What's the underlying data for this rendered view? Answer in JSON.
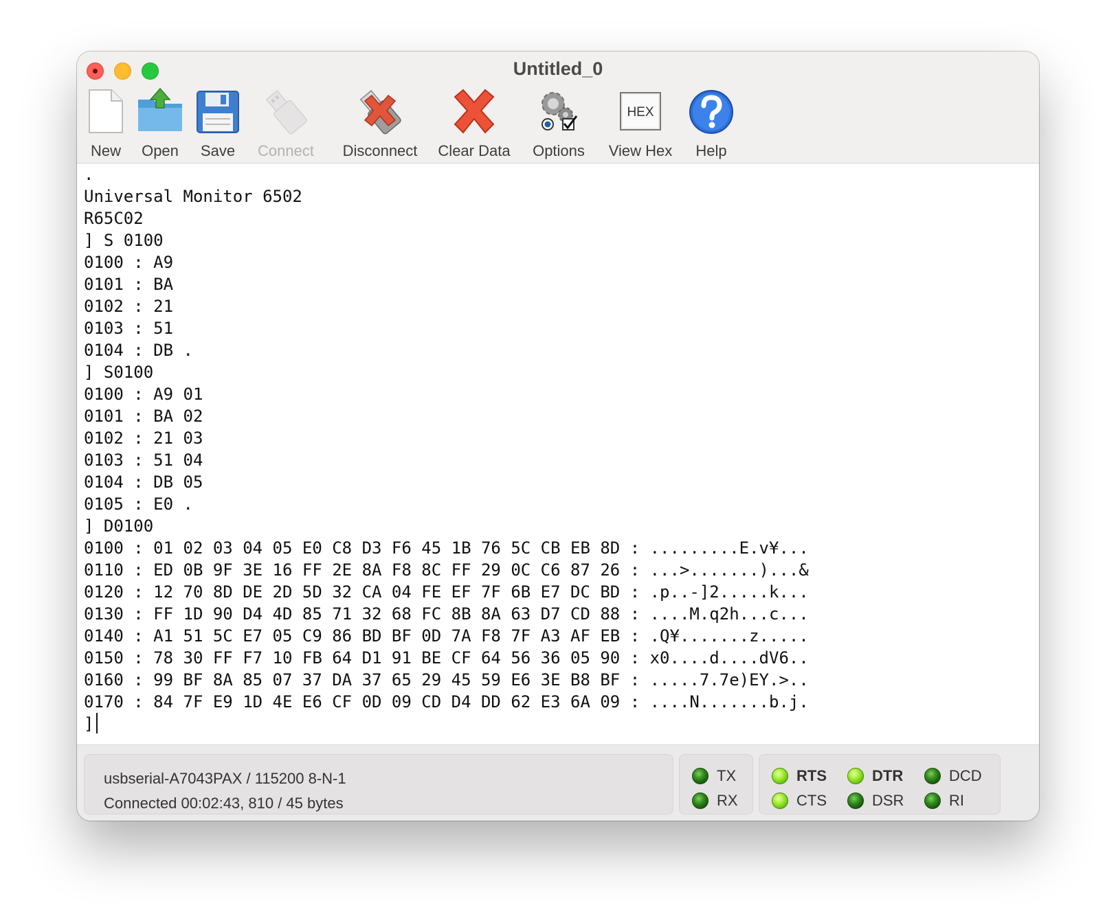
{
  "window": {
    "title": "Untitled_0"
  },
  "toolbar": {
    "new_label": "New",
    "open_label": "Open",
    "save_label": "Save",
    "connect_label": "Connect",
    "disconnect_label": "Disconnect",
    "clear_label": "Clear Data",
    "options_label": "Options",
    "viewhex_label": "View Hex",
    "viewhex_icon_text": "HEX",
    "help_label": "Help"
  },
  "terminal": {
    "lines": [
      ".",
      "Universal Monitor 6502",
      "R65C02",
      "] S 0100",
      "0100 : A9",
      "0101 : BA",
      "0102 : 21",
      "0103 : 51",
      "0104 : DB .",
      "] S0100",
      "0100 : A9 01",
      "0101 : BA 02",
      "0102 : 21 03",
      "0103 : 51 04",
      "0104 : DB 05",
      "0105 : E0 .",
      "] D0100",
      "0100 : 01 02 03 04 05 E0 C8 D3 F6 45 1B 76 5C CB EB 8D : .........E.v¥...",
      "0110 : ED 0B 9F 3E 16 FF 2E 8A F8 8C FF 29 0C C6 87 26 : ...>.......)...&",
      "0120 : 12 70 8D DE 2D 5D 32 CA 04 FE EF 7F 6B E7 DC BD : .p..-]2.....k...",
      "0130 : FF 1D 90 D4 4D 85 71 32 68 FC 8B 8A 63 D7 CD 88 : ....M.q2h...c...",
      "0140 : A1 51 5C E7 05 C9 86 BD BF 0D 7A F8 7F A3 AF EB : .Q¥.......z.....",
      "0150 : 78 30 FF F7 10 FB 64 D1 91 BE CF 64 56 36 05 90 : x0....d....dV6..",
      "0160 : 99 BF 8A 85 07 37 DA 37 65 29 45 59 E6 3E B8 BF : .....7.7e)EY.>..",
      "0170 : 84 7F E9 1D 4E E6 CF 0D 09 CD D4 DD 62 E3 6A 09 : ....N.......b.j."
    ],
    "prompt": "]"
  },
  "status": {
    "port": "usbserial-A7043PAX / 115200 8-N-1",
    "connection": "Connected 00:02:43, 810 / 45 bytes",
    "signals": {
      "tx": {
        "label": "TX",
        "active": false
      },
      "rx": {
        "label": "RX",
        "active": false
      },
      "rts": {
        "label": "RTS",
        "active": true
      },
      "cts": {
        "label": "CTS",
        "active": true
      },
      "dtr": {
        "label": "DTR",
        "active": true
      },
      "dsr": {
        "label": "DSR",
        "active": false
      },
      "dcd": {
        "label": "DCD",
        "active": false
      },
      "ri": {
        "label": "RI",
        "active": false
      }
    }
  }
}
